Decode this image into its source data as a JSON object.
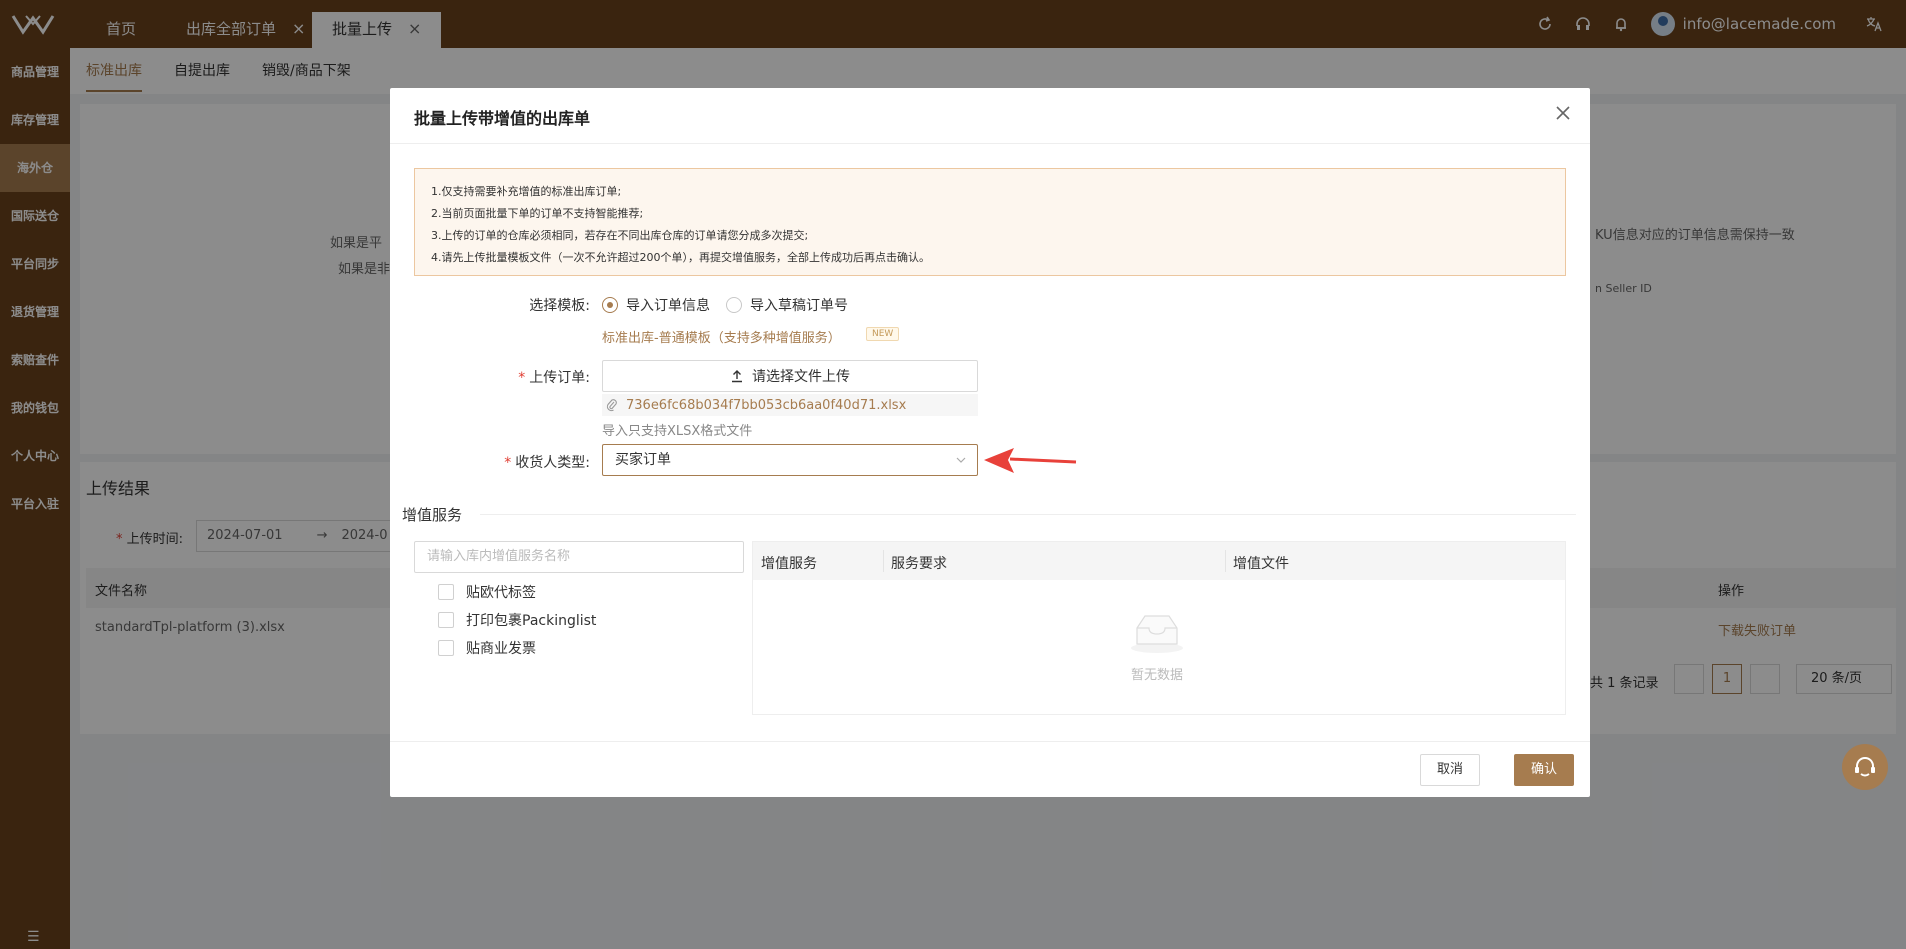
{
  "colors": {
    "brand": "#6b421c",
    "accent": "#a67c4f",
    "required": "#e03c31",
    "annotation_arrow": "#e8413a"
  },
  "topbar": {
    "tabs": [
      {
        "label": "首页"
      },
      {
        "label": "出库全部订单"
      },
      {
        "label": "批量上传"
      }
    ],
    "close_glyph": "×",
    "user_email": "info@lacemade.com",
    "icons": [
      "refresh-icon",
      "headset-icon",
      "bell-icon",
      "avatar",
      "translate-icon"
    ]
  },
  "sidebar": {
    "items": [
      {
        "label": "商品管理"
      },
      {
        "label": "库存管理"
      },
      {
        "label": "海外仓"
      },
      {
        "label": "国际送仓"
      },
      {
        "label": "平台同步"
      },
      {
        "label": "退货管理"
      },
      {
        "label": "索赔查件"
      },
      {
        "label": "我的钱包"
      },
      {
        "label": "个人中心"
      },
      {
        "label": "平台入驻"
      }
    ],
    "collapse_glyph": "☰"
  },
  "subtabs": [
    {
      "label": "标准出库"
    },
    {
      "label": "自提出库"
    },
    {
      "label": "销毁/商品下架"
    }
  ],
  "background": {
    "partial_text_1": "如果是平",
    "partial_text_2": "如果是非",
    "partial_text_3": "KU信息对应的订单信息需保持一致",
    "partial_text_4": "n Seller ID",
    "upload_result_title": "上传结果",
    "upload_time_label": "上传时间:",
    "date_start": "2024-07-01",
    "date_end_partial": "2024-0",
    "col_file_name": "文件名称",
    "col_action": "操作",
    "row_file": "standardTpl-platform (3).xlsx",
    "row_action": "下载失败订单",
    "total": "共 1 条记录",
    "page": "1",
    "page_size": "20 条/页"
  },
  "modal": {
    "title": "批量上传带增值的出库单",
    "notices": [
      "1.仅支持需要补充增值的标准出库订单;",
      "2.当前页面批量下单的订单不支持智能推荐;",
      "3.上传的订单的仓库必须相同，若存在不同出库仓库的订单请您分成多次提交;",
      "4.请先上传批量模板文件（一次不允许超过200个单），再提交增值服务，全部上传成功后再点击确认。"
    ],
    "template_label": "选择模板:",
    "template_options": [
      {
        "label": "导入订单信息",
        "selected": true
      },
      {
        "label": "导入草稿订单号",
        "selected": false
      }
    ],
    "template_link": "标准出库-普通模板（支持多种增值服务）",
    "new_badge": "NEW",
    "upload_label": "上传订单:",
    "upload_button": "请选择文件上传",
    "uploaded_file": "736e6fc68b034f7bb053cb6aa0f40d71.xlsx",
    "upload_hint": "导入只支持XLSX格式文件",
    "receiver_label": "收货人类型:",
    "receiver_value": "买家订单",
    "value_added_title": "增值服务",
    "search_placeholder": "请输入库内增值服务名称",
    "services": [
      {
        "label": "贴欧代标签"
      },
      {
        "label": "打印包裹Packinglist"
      },
      {
        "label": "贴商业发票"
      }
    ],
    "table_headers": [
      "增值服务",
      "服务要求",
      "增值文件"
    ],
    "empty_text": "暂无数据",
    "cancel_button": "取消",
    "confirm_button": "确认"
  }
}
